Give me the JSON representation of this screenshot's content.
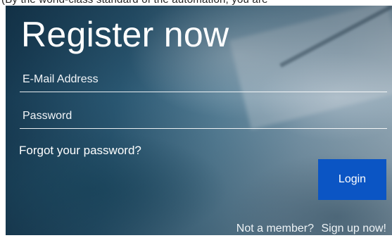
{
  "top_banner": {
    "cut_text": "(By the world-class standard of the automation, you are"
  },
  "form": {
    "title": "Register now",
    "email": {
      "placeholder": "E-Mail Address",
      "value": ""
    },
    "password": {
      "placeholder": "Password",
      "value": ""
    },
    "forgot_link": "Forgot your password?",
    "login_label": "Login",
    "footer": {
      "prompt": "Not a member?",
      "signup_link": "Sign up now!"
    }
  },
  "colors": {
    "login_button": "#0b55c4",
    "text": "#ffffff"
  }
}
